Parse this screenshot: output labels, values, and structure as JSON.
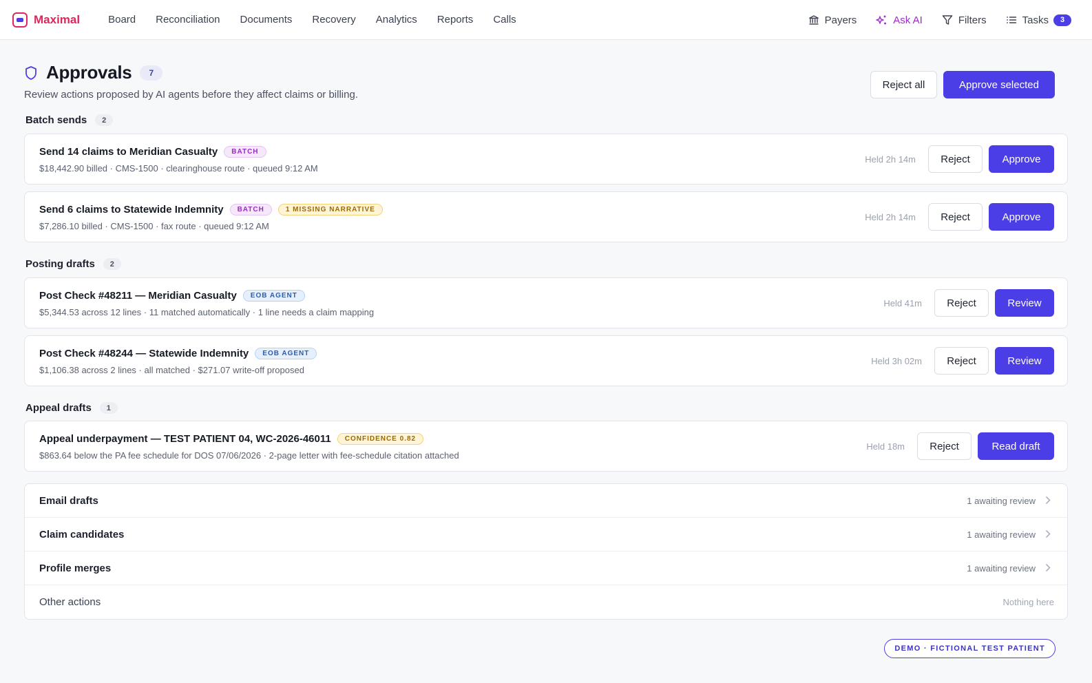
{
  "brand": {
    "name": "Maximal"
  },
  "nav": [
    "Board",
    "Reconciliation",
    "Documents",
    "Recovery",
    "Analytics",
    "Reports",
    "Calls"
  ],
  "nav_right": {
    "payers": "Payers",
    "ask_ai": "Ask AI",
    "filters": "Filters",
    "tasks": "Tasks",
    "tasks_count": "3"
  },
  "header": {
    "title": "Approvals",
    "count": "7",
    "subtitle": "Review actions proposed by AI agents before they affect claims or billing.",
    "reject_all": "Reject all",
    "approve_selected": "Approve selected"
  },
  "sections": [
    {
      "label": "Batch sends",
      "count": "2",
      "items": [
        {
          "title": "Send 14 claims to Meridian Casualty",
          "tags": [
            "BATCH"
          ],
          "detail": "$18,442.90 billed · CMS-1500 · clearinghouse route · queued 9:12 AM",
          "held": "Held 2h 14m",
          "reject": "Reject",
          "action": "Approve"
        },
        {
          "title": "Send 6 claims to Statewide Indemnity",
          "tags": [
            "BATCH",
            "1 MISSING NARRATIVE"
          ],
          "detail": "$7,286.10 billed · CMS-1500 · fax route · queued 9:12 AM",
          "held": "Held 2h 14m",
          "reject": "Reject",
          "action": "Approve"
        }
      ]
    },
    {
      "label": "Posting drafts",
      "count": "2",
      "items": [
        {
          "title": "Post Check #48211 — Meridian Casualty",
          "tags": [
            "EOB AGENT"
          ],
          "detail": "$5,344.53 across 12 lines · 11 matched automatically · 1 line needs a claim mapping",
          "held": "Held 41m",
          "reject": "Reject",
          "action": "Review"
        },
        {
          "title": "Post Check #48244 — Statewide Indemnity",
          "tags": [
            "EOB AGENT"
          ],
          "detail": "$1,106.38 across 2 lines · all matched · $271.07 write-off proposed",
          "held": "Held 3h 02m",
          "reject": "Reject",
          "action": "Review"
        }
      ]
    },
    {
      "label": "Appeal drafts",
      "count": "1",
      "items": [
        {
          "title": "Appeal underpayment — TEST PATIENT 04, WC-2026-46011",
          "tags": [
            "CONFIDENCE 0.82"
          ],
          "detail": "$863.64 below the PA fee schedule for DOS 07/06/2026 · 2-page letter with fee-schedule citation attached",
          "held": "Held 18m",
          "reject": "Reject",
          "action": "Read draft"
        }
      ]
    }
  ],
  "collapsed": [
    {
      "label": "Email drafts",
      "status": "1 awaiting review"
    },
    {
      "label": "Claim candidates",
      "status": "1 awaiting review"
    },
    {
      "label": "Profile merges",
      "status": "1 awaiting review"
    },
    {
      "label": "Other actions",
      "status": "Nothing here"
    }
  ],
  "demo_badge": "DEMO · FICTIONAL TEST PATIENT",
  "colors": {
    "accent": "#4b3ee6",
    "brand": "#e0245e",
    "ai": "#a029c9",
    "batch_tag": "#9b2bc7",
    "warning_tag": "#9a6a06",
    "eob_tag": "#2a5db0"
  },
  "icons": {
    "brand": "brand-logo-icon",
    "payers": "bank-icon",
    "ask_ai": "sparkle-icon",
    "filters": "filter-icon",
    "tasks": "list-icon",
    "approvals": "shield-icon",
    "row": "chevron-right-icon"
  }
}
